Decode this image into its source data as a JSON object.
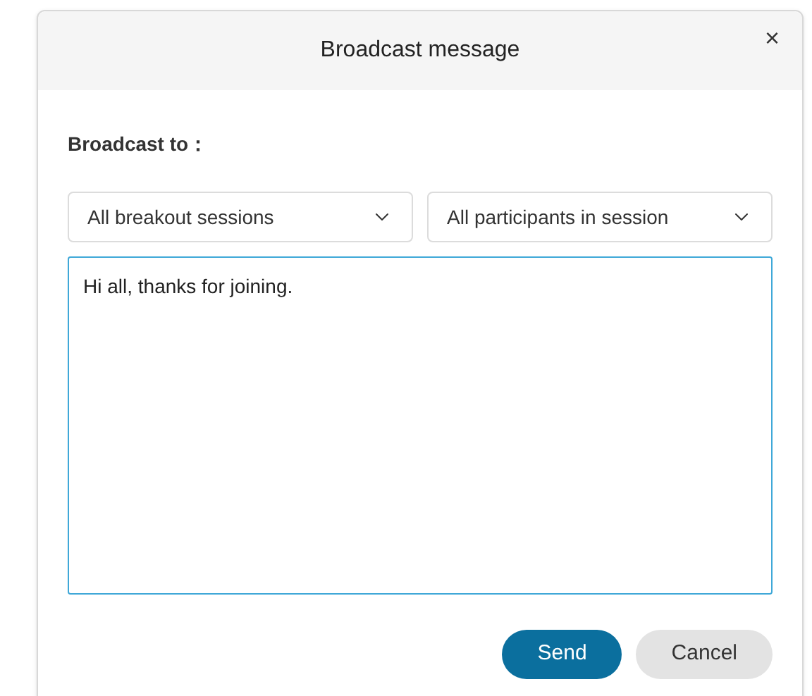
{
  "dialog": {
    "title": "Broadcast message",
    "close": "×"
  },
  "label": "Broadcast to：",
  "dropdowns": [
    {
      "value": "All breakout sessions"
    },
    {
      "value": "All participants in session"
    }
  ],
  "message": {
    "value": "Hi all, thanks for joining."
  },
  "buttons": [
    {
      "label": "Send",
      "kind": "primary"
    },
    {
      "label": "Cancel",
      "kind": "secondary"
    }
  ]
}
